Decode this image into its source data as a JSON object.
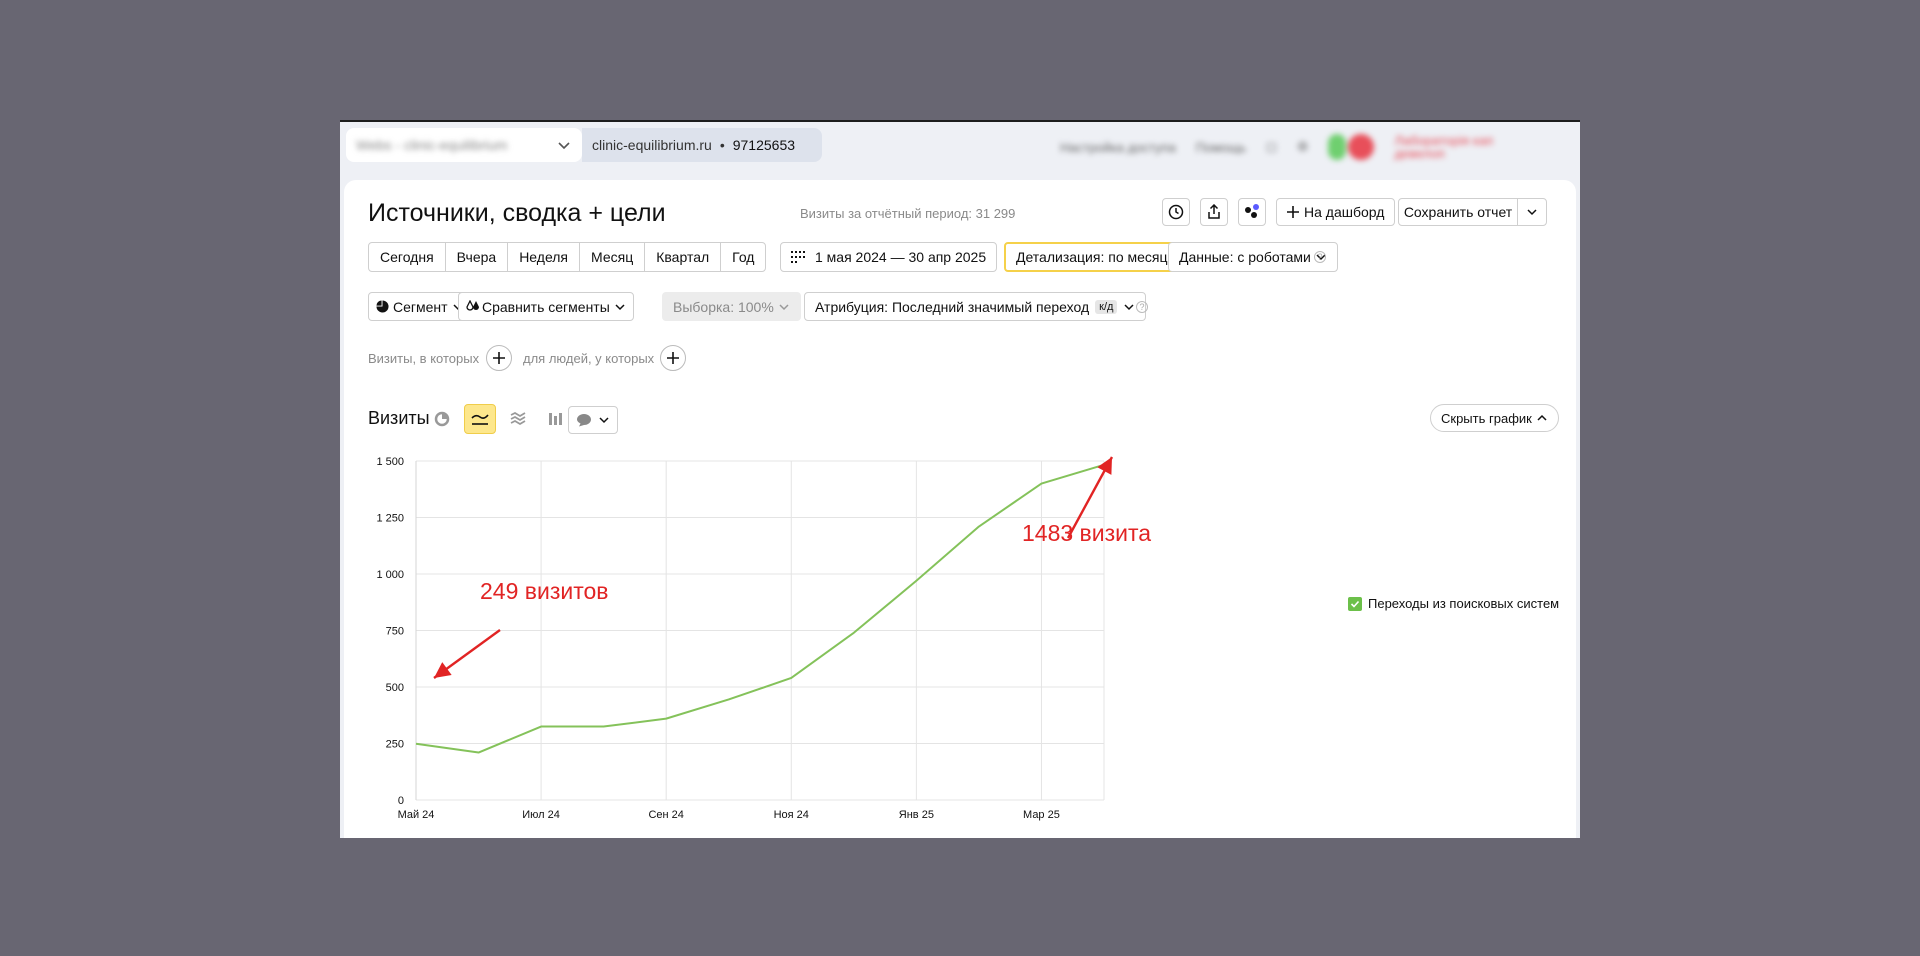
{
  "site": {
    "name_blurred": "Webs - clinic-equilibrium",
    "domain": "clinic-equilibrium.ru",
    "counter_id": "97125653"
  },
  "topbar_right": {
    "settings_blurred": "Настройка доступа",
    "help_blurred": "Помощь",
    "user_blurred_line1": "Лабораторія кап",
    "user_blurred_line2": "девелоп"
  },
  "report": {
    "title": "Источники, сводка + цели",
    "visits_total": "Визиты за отчётный период: 31 299",
    "dashboard_label": "На дашборд",
    "save_label": "Сохранить отчет"
  },
  "periods": [
    "Сегодня",
    "Вчера",
    "Неделя",
    "Месяц",
    "Квартал",
    "Год"
  ],
  "date_range": "1 мая 2024 — 30 апр 2025",
  "detail_label": "Детализация: по месяцам",
  "data_label": "Данные: с роботами",
  "segment_label": "Сегмент",
  "compare_label": "Сравнить сегменты",
  "sample_label": "Выборка: 100%",
  "attribution_label": "Атрибуция: Последний значимый переход",
  "attribution_badge": "к/д",
  "filter_visits": "Визиты, в которых",
  "filter_people": "для людей, у которых",
  "chart_header": {
    "title": "Визиты",
    "hide_label": "Скрыть график"
  },
  "colors": {
    "line": "#84c25a",
    "annotation": "#e12424",
    "active_toggle": "#fde78c",
    "highlight_border": "#f5d14a"
  },
  "icons": [
    "clock-icon",
    "share-icon",
    "apps-icon",
    "plus-icon",
    "chevron-down-icon",
    "calendar-grid-icon",
    "pie-icon",
    "drop-icon",
    "pie-chart-icon",
    "line-chart-icon",
    "area-chart-icon",
    "bar-chart-icon",
    "comment-icon",
    "chevron-up-icon",
    "checkbox-icon",
    "question-icon"
  ],
  "annotations": {
    "start": "249 визитов",
    "end": "1483 визита"
  },
  "chart_data": {
    "type": "line",
    "x": [
      "Май 24",
      "Июн 24",
      "Июл 24",
      "Авг 24",
      "Сен 24",
      "Окт 24",
      "Ноя 24",
      "Дек 24",
      "Янв 25",
      "Фев 25",
      "Мар 25",
      "Апр 25"
    ],
    "x_tick_labels": [
      "Май 24",
      "Июл 24",
      "Сен 24",
      "Ноя 24",
      "Янв 25",
      "Мар 25"
    ],
    "y_ticks": [
      0,
      250,
      500,
      750,
      1000,
      1250,
      1500
    ],
    "y_tick_labels": [
      "0",
      "250",
      "500",
      "750",
      "1 000",
      "1 250",
      "1 500"
    ],
    "ylim": [
      0,
      1500
    ],
    "grid": true,
    "legend_position": "right",
    "series": [
      {
        "name": "Переходы из поисковых систем",
        "values": [
          249,
          210,
          325,
          325,
          360,
          445,
          540,
          740,
          970,
          1210,
          1400,
          1483
        ]
      }
    ]
  }
}
